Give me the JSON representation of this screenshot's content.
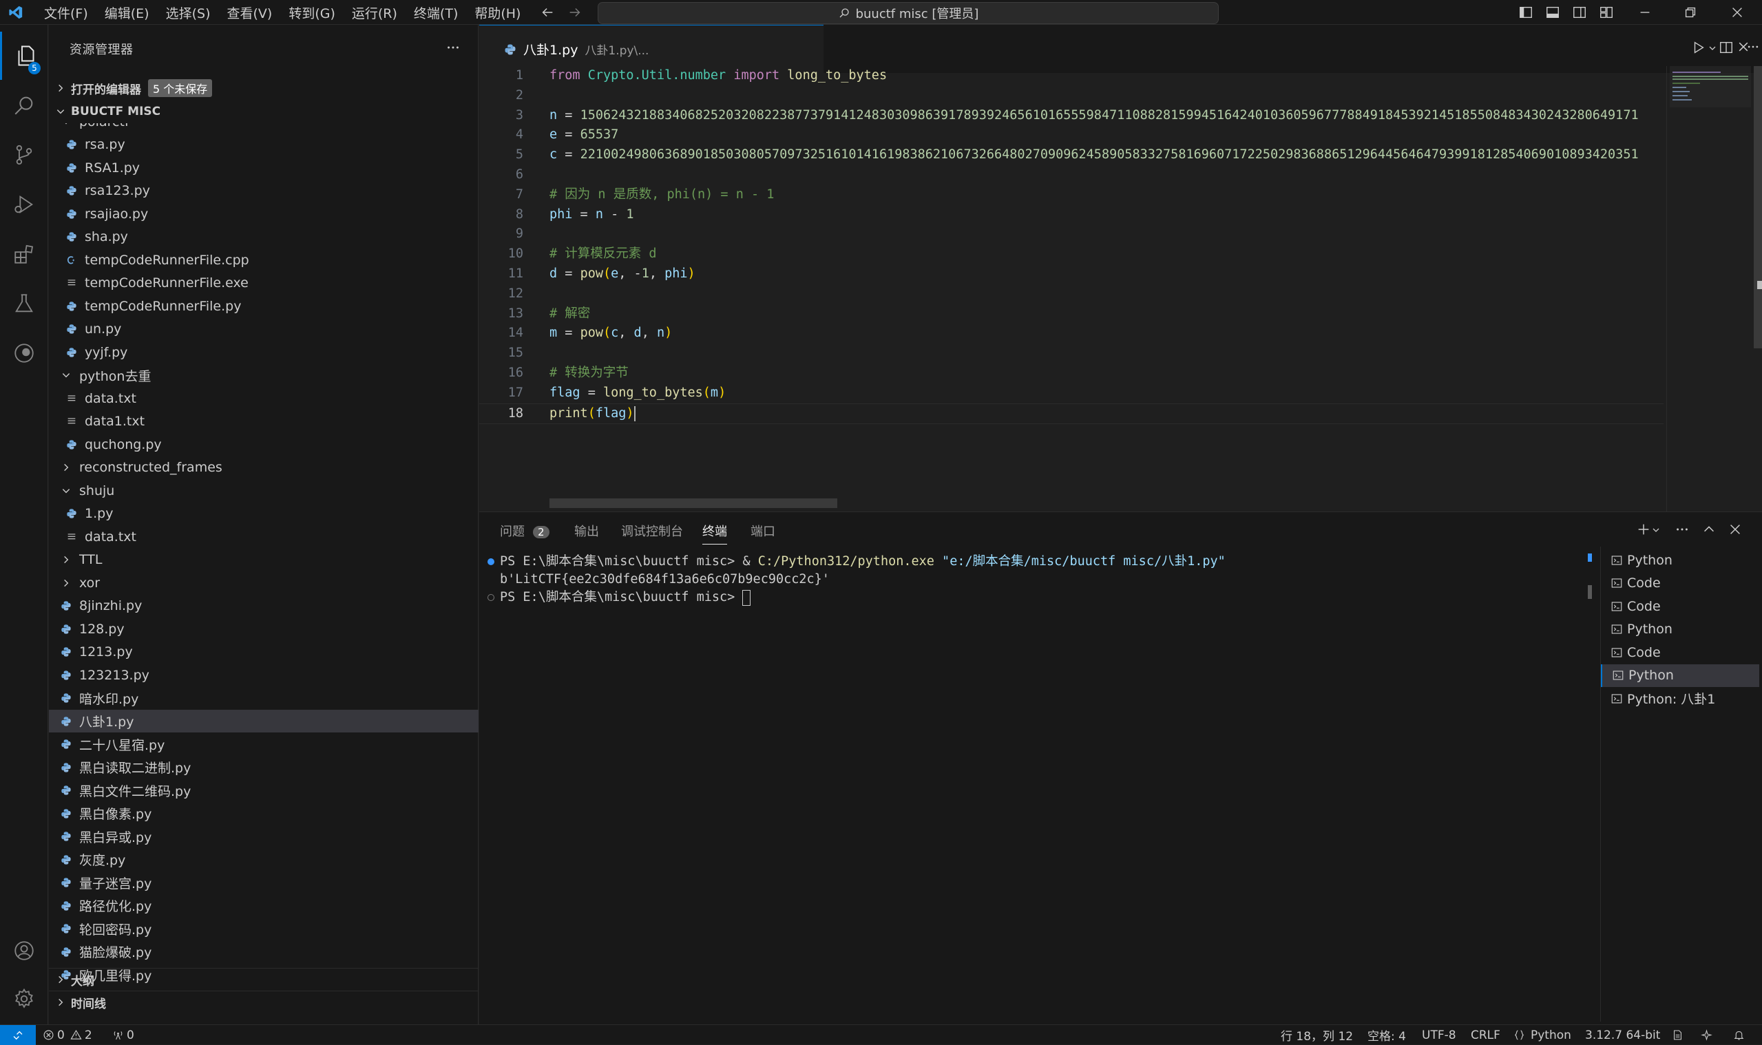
{
  "menu": [
    "文件(F)",
    "编辑(E)",
    "选择(S)",
    "查看(V)",
    "转到(G)",
    "运行(R)",
    "终端(T)",
    "帮助(H)"
  ],
  "search_title": "buuctf misc [管理员]",
  "explorer": {
    "title": "资源管理器",
    "open_editors": "打开的编辑器",
    "unsaved_badge": "5 个未保存",
    "workspace": "BUUCTF MISC",
    "scm_badge": "5",
    "outline": "大纲",
    "timeline": "时间线",
    "tree": [
      {
        "label": "polarctf",
        "type": "folder-open",
        "depth": 1
      },
      {
        "label": "rsa.py",
        "type": "py",
        "depth": 2
      },
      {
        "label": "RSA1.py",
        "type": "py",
        "depth": 2
      },
      {
        "label": "rsa123.py",
        "type": "py",
        "depth": 2
      },
      {
        "label": "rsajiao.py",
        "type": "py",
        "depth": 2
      },
      {
        "label": "sha.py",
        "type": "py",
        "depth": 2
      },
      {
        "label": "tempCodeRunnerFile.cpp",
        "type": "cpp",
        "depth": 2
      },
      {
        "label": "tempCodeRunnerFile.exe",
        "type": "txt",
        "depth": 2
      },
      {
        "label": "tempCodeRunnerFile.py",
        "type": "py",
        "depth": 2
      },
      {
        "label": "un.py",
        "type": "py",
        "depth": 2
      },
      {
        "label": "yyjf.py",
        "type": "py",
        "depth": 2
      },
      {
        "label": "python去重",
        "type": "folder-open",
        "depth": 1
      },
      {
        "label": "data.txt",
        "type": "txt",
        "depth": 2
      },
      {
        "label": "data1.txt",
        "type": "txt",
        "depth": 2
      },
      {
        "label": "quchong.py",
        "type": "py",
        "depth": 2
      },
      {
        "label": "reconstructed_frames",
        "type": "folder",
        "depth": 1
      },
      {
        "label": "shuju",
        "type": "folder-open",
        "depth": 1
      },
      {
        "label": "1.py",
        "type": "py",
        "depth": 2
      },
      {
        "label": "data.txt",
        "type": "txt",
        "depth": 2
      },
      {
        "label": "TTL",
        "type": "folder",
        "depth": 1
      },
      {
        "label": "xor",
        "type": "folder",
        "depth": 1
      },
      {
        "label": "8jinzhi.py",
        "type": "py",
        "depth": 1
      },
      {
        "label": "128.py",
        "type": "py",
        "depth": 1
      },
      {
        "label": "1213.py",
        "type": "py",
        "depth": 1
      },
      {
        "label": "123213.py",
        "type": "py",
        "depth": 1
      },
      {
        "label": "暗水印.py",
        "type": "py",
        "depth": 1
      },
      {
        "label": "八卦1.py",
        "type": "py",
        "depth": 1,
        "selected": true
      },
      {
        "label": "二十八星宿.py",
        "type": "py",
        "depth": 1
      },
      {
        "label": "黑白读取二进制.py",
        "type": "py",
        "depth": 1
      },
      {
        "label": "黑白文件二维码.py",
        "type": "py",
        "depth": 1
      },
      {
        "label": "黑白像素.py",
        "type": "py",
        "depth": 1
      },
      {
        "label": "黑白异或.py",
        "type": "py",
        "depth": 1
      },
      {
        "label": "灰度.py",
        "type": "py",
        "depth": 1
      },
      {
        "label": "量子迷宫.py",
        "type": "py",
        "depth": 1
      },
      {
        "label": "路径优化.py",
        "type": "py",
        "depth": 1
      },
      {
        "label": "轮回密码.py",
        "type": "py",
        "depth": 1
      },
      {
        "label": "猫脸爆破.py",
        "type": "py",
        "depth": 1
      },
      {
        "label": "欧几里得.py",
        "type": "py",
        "depth": 1
      }
    ]
  },
  "editor": {
    "tab_name": "八卦1.py",
    "tab_path": "八卦1.py\\...",
    "current_line": 18,
    "lines": [
      [
        {
          "t": "from",
          "c": "kw"
        },
        {
          "t": " ",
          "c": "pl"
        },
        {
          "t": "Crypto.Util.number",
          "c": "mod"
        },
        {
          "t": " ",
          "c": "pl"
        },
        {
          "t": "import",
          "c": "kw"
        },
        {
          "t": " long_to_bytes",
          "c": "fn"
        }
      ],
      [],
      [
        {
          "t": "n",
          "c": "var"
        },
        {
          "t": " = ",
          "c": "pl"
        },
        {
          "t": "150624321883406825203208223877379141248303098639178939246561016555984711088281599451642401036059677788491845392145185508483430243280649171",
          "c": "num"
        }
      ],
      [
        {
          "t": "e",
          "c": "var"
        },
        {
          "t": " = ",
          "c": "pl"
        },
        {
          "t": "65537",
          "c": "num"
        }
      ],
      [
        {
          "t": "c",
          "c": "var"
        },
        {
          "t": " = ",
          "c": "pl"
        },
        {
          "t": "221002498063689018503080570973251610141619838621067326648027090962458905833275816960717225029836886512964456464793991812854069010893420351",
          "c": "num"
        }
      ],
      [],
      [
        {
          "t": "# 因为 n 是质数, phi(n) = n - 1",
          "c": "cm"
        }
      ],
      [
        {
          "t": "phi",
          "c": "var"
        },
        {
          "t": " = ",
          "c": "pl"
        },
        {
          "t": "n",
          "c": "var"
        },
        {
          "t": " - ",
          "c": "pl"
        },
        {
          "t": "1",
          "c": "num"
        }
      ],
      [],
      [
        {
          "t": "# 计算模反元素 d",
          "c": "cm"
        }
      ],
      [
        {
          "t": "d",
          "c": "var"
        },
        {
          "t": " = ",
          "c": "pl"
        },
        {
          "t": "pow",
          "c": "fn"
        },
        {
          "t": "(",
          "c": "br"
        },
        {
          "t": "e",
          "c": "var"
        },
        {
          "t": ", -",
          "c": "pl"
        },
        {
          "t": "1",
          "c": "num"
        },
        {
          "t": ", ",
          "c": "pl"
        },
        {
          "t": "phi",
          "c": "var"
        },
        {
          "t": ")",
          "c": "br"
        }
      ],
      [],
      [
        {
          "t": "# 解密",
          "c": "cm"
        }
      ],
      [
        {
          "t": "m",
          "c": "var"
        },
        {
          "t": " = ",
          "c": "pl"
        },
        {
          "t": "pow",
          "c": "fn"
        },
        {
          "t": "(",
          "c": "br"
        },
        {
          "t": "c",
          "c": "var"
        },
        {
          "t": ", ",
          "c": "pl"
        },
        {
          "t": "d",
          "c": "var"
        },
        {
          "t": ", ",
          "c": "pl"
        },
        {
          "t": "n",
          "c": "var"
        },
        {
          "t": ")",
          "c": "br"
        }
      ],
      [],
      [
        {
          "t": "# 转换为字节",
          "c": "cm"
        }
      ],
      [
        {
          "t": "flag",
          "c": "var"
        },
        {
          "t": " = ",
          "c": "pl"
        },
        {
          "t": "long_to_bytes",
          "c": "fn"
        },
        {
          "t": "(",
          "c": "br"
        },
        {
          "t": "m",
          "c": "var"
        },
        {
          "t": ")",
          "c": "br"
        }
      ],
      [
        {
          "t": "print",
          "c": "fn"
        },
        {
          "t": "(",
          "c": "br"
        },
        {
          "t": "flag",
          "c": "var"
        },
        {
          "t": ")",
          "c": "br"
        }
      ]
    ]
  },
  "panel": {
    "tabs": [
      "问题",
      "输出",
      "调试控制台",
      "终端",
      "端口"
    ],
    "problems_count": "2",
    "active_tab": "终端",
    "terminal": {
      "prompt1": "PS E:\\脚本合集\\misc\\buuctf misc> ",
      "amp": "& ",
      "exe": "C:/Python312/python.exe",
      "arg": " \"e:/脚本合集/misc/buuctf misc/八卦1.py\"",
      "output": "b'LitCTF{ee2c30dfe684f13a6e6c07b9ec90cc2c}'",
      "prompt2": "PS E:\\脚本合集\\misc\\buuctf misc> "
    },
    "terminal_list": [
      "Python",
      "Code",
      "Code",
      "Python",
      "Code",
      "Python",
      "Python: 八卦1"
    ],
    "terminal_active_index": 5
  },
  "status": {
    "errors": "0",
    "warnings": "2",
    "ports": "0",
    "position": "行 18，列 12",
    "spaces": "空格: 4",
    "encoding": "UTF-8",
    "eol": "CRLF",
    "language": "Python",
    "interpreter": "3.12.7 64-bit"
  }
}
